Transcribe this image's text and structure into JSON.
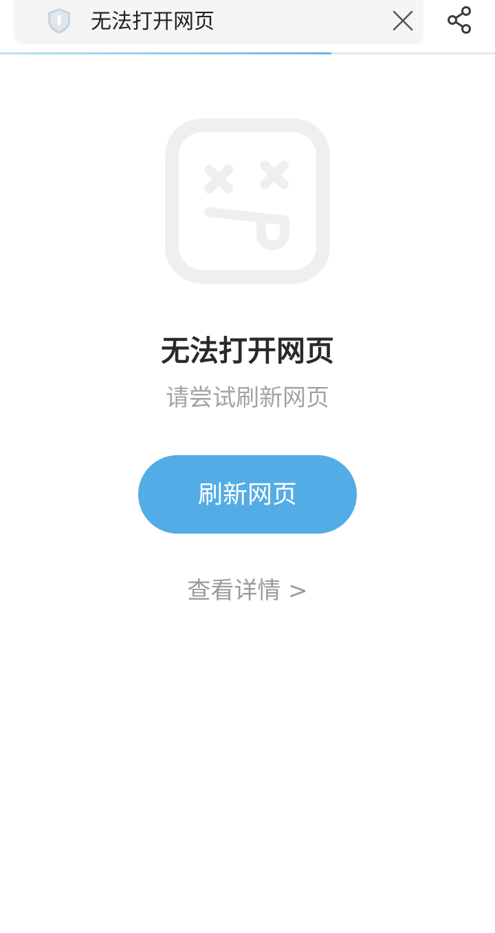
{
  "header": {
    "url_title": "无法打开网页",
    "security_icon": "shield-icon",
    "close_icon": "close-icon",
    "share_icon": "share-icon",
    "load_progress_percent": 67
  },
  "error": {
    "illustration_icon": "broken-page-face-icon",
    "title": "无法打开网页",
    "subtitle": "请尝试刷新网页"
  },
  "actions": {
    "refresh_label": "刷新网页",
    "details_label": "查看详情  >"
  },
  "colors": {
    "accent": "#53ace5",
    "title_text": "#2a2a2a",
    "muted_text": "#a3a3a3",
    "url_box_bg": "#f5f5f5",
    "illustration": "#efefef"
  }
}
